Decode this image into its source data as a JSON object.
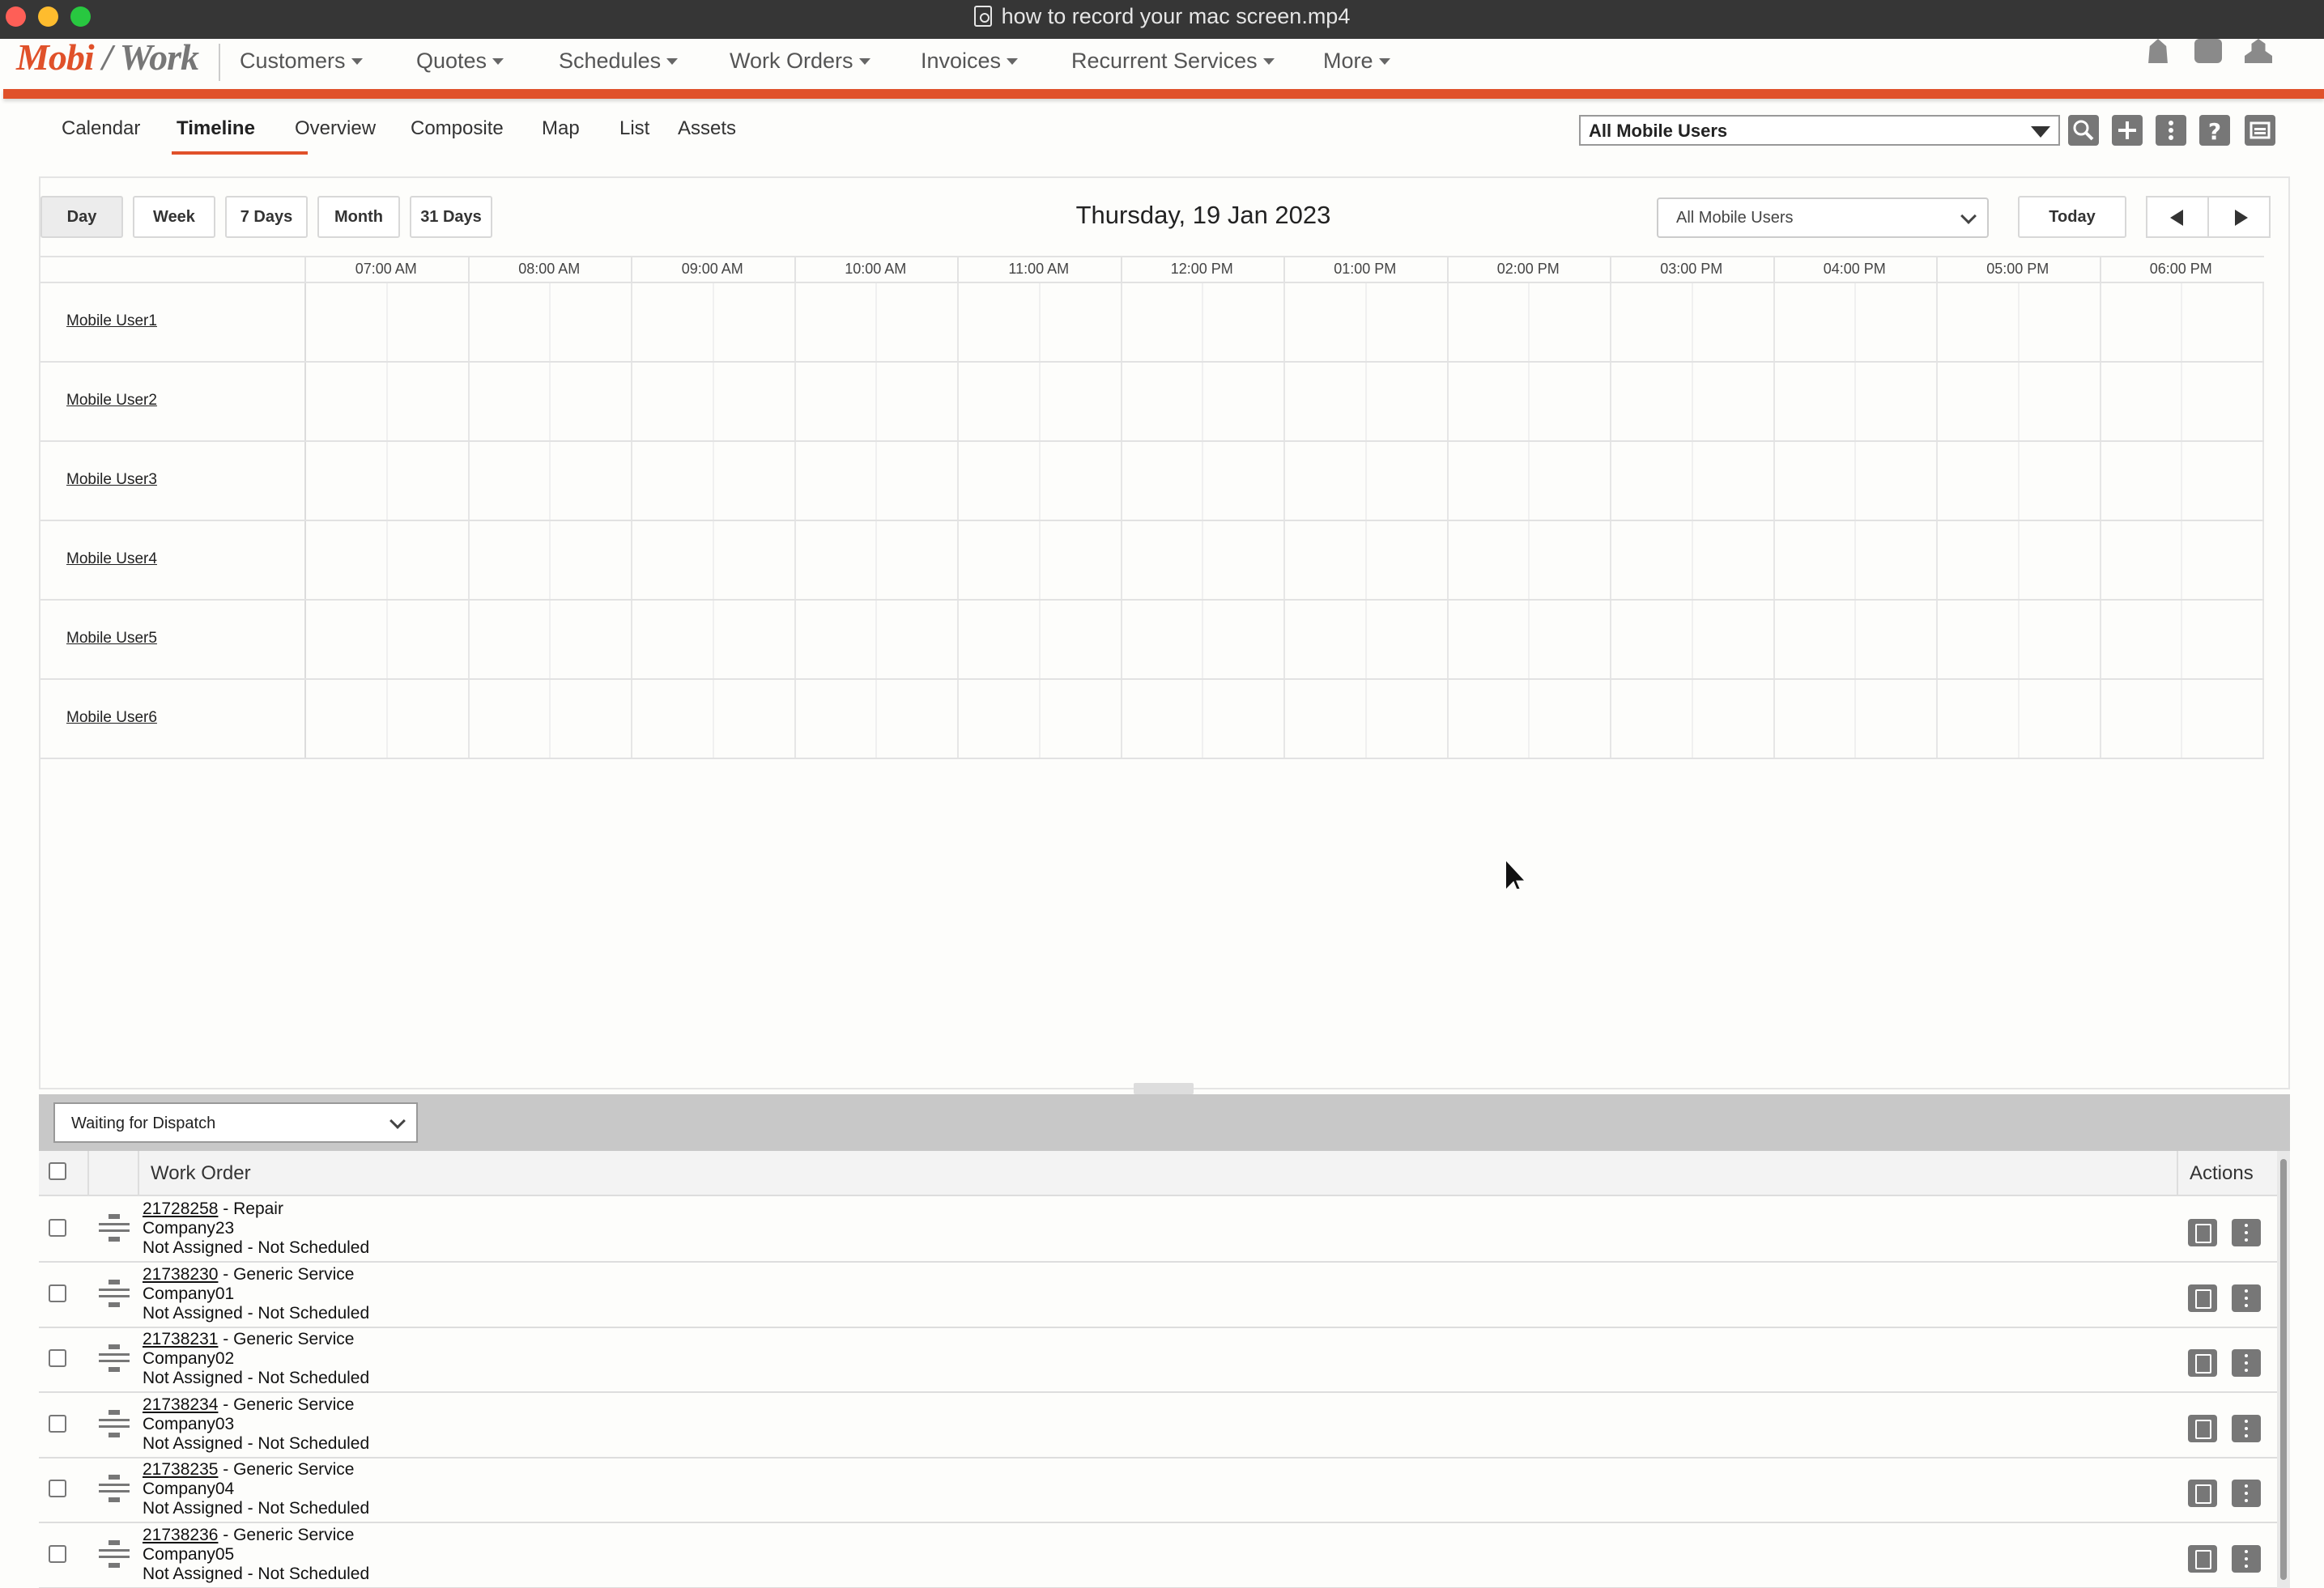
{
  "window": {
    "title": "how to record your mac screen.mp4"
  },
  "app": {
    "logo_left": "Mobi",
    "logo_right": "Work",
    "nav": [
      {
        "label": "Customers"
      },
      {
        "label": "Quotes"
      },
      {
        "label": "Schedules"
      },
      {
        "label": "Work Orders"
      },
      {
        "label": "Invoices"
      },
      {
        "label": "Recurrent Services"
      },
      {
        "label": "More"
      }
    ],
    "header_icons": [
      "bell-icon",
      "chat-icon",
      "user-icon"
    ],
    "accent": "#e0512a"
  },
  "subtabs": [
    {
      "label": "Calendar"
    },
    {
      "label": "Timeline",
      "active": true
    },
    {
      "label": "Overview"
    },
    {
      "label": "Composite"
    },
    {
      "label": "Map"
    },
    {
      "label": "List"
    },
    {
      "label": "Assets"
    }
  ],
  "toolbar": {
    "user_filter": "All Mobile Users",
    "icons": [
      "search-icon",
      "plus-icon",
      "more-vertical-icon",
      "help-icon",
      "print-icon"
    ]
  },
  "calendar": {
    "views": [
      {
        "label": "Day",
        "active": true
      },
      {
        "label": "Week"
      },
      {
        "label": "7 Days"
      },
      {
        "label": "Month"
      },
      {
        "label": "31 Days"
      }
    ],
    "date_title": "Thursday, 19 Jan 2023",
    "user_select": "All Mobile Users",
    "today_label": "Today",
    "hours": [
      "07:00 AM",
      "08:00 AM",
      "09:00 AM",
      "10:00 AM",
      "11:00 AM",
      "12:00 PM",
      "01:00 PM",
      "02:00 PM",
      "03:00 PM",
      "04:00 PM",
      "05:00 PM",
      "06:00 PM"
    ],
    "users": [
      "Mobile User1",
      "Mobile User2",
      "Mobile User3",
      "Mobile User4",
      "Mobile User5",
      "Mobile User6"
    ]
  },
  "dispatch": {
    "filter": "Waiting for Dispatch",
    "col_work_order": "Work Order",
    "col_actions": "Actions",
    "rows": [
      {
        "number": "21728258",
        "type": " - Repair",
        "company": "Company23",
        "status": "Not Assigned - Not Scheduled"
      },
      {
        "number": "21738230",
        "type": " - Generic Service",
        "company": "Company01",
        "status": "Not Assigned - Not Scheduled"
      },
      {
        "number": "21738231",
        "type": " - Generic Service",
        "company": "Company02",
        "status": "Not Assigned - Not Scheduled"
      },
      {
        "number": "21738234",
        "type": " - Generic Service",
        "company": "Company03",
        "status": "Not Assigned - Not Scheduled"
      },
      {
        "number": "21738235",
        "type": " - Generic Service",
        "company": "Company04",
        "status": "Not Assigned - Not Scheduled"
      },
      {
        "number": "21738236",
        "type": " - Generic Service",
        "company": "Company05",
        "status": "Not Assigned - Not Scheduled"
      }
    ]
  }
}
